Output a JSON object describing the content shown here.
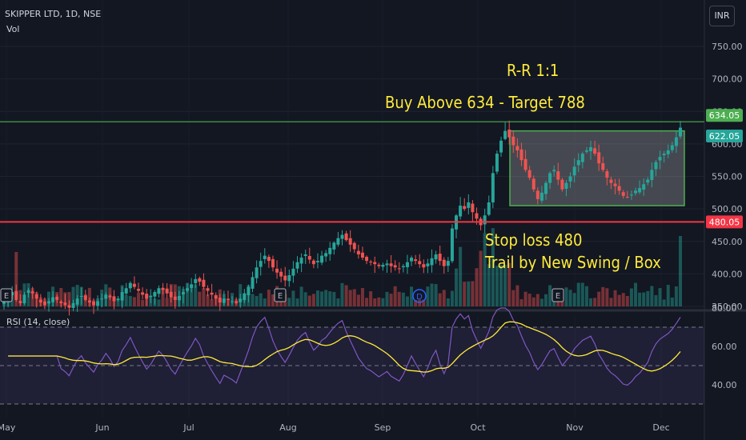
{
  "header": {
    "symbol": "SKIPPER LTD, 1D, NSE",
    "vol_label": "Vol",
    "currency_button": "INR",
    "rsi_label": "RSI (14, close)"
  },
  "annotations": {
    "rr": "R-R 1:1",
    "buy": "Buy Above 634 - Target 788",
    "stop": "Stop loss 480",
    "trail": "Trail by New Swing / Box"
  },
  "colors": {
    "background": "#131722",
    "up": "#26a69a",
    "down": "#ef5350",
    "target_line": "#4caf50",
    "stop_line": "#f23645",
    "rsi_line": "#7e57c2",
    "rsi_ma": "#ffeb3b",
    "annotation": "#ffeb3b"
  },
  "icons": {
    "earnings": "earnings-marker-icon",
    "dividend": "dividend-marker-icon"
  },
  "chart_data": [
    {
      "type": "candlestick",
      "title": "SKIPPER LTD, 1D, NSE",
      "x_tick_labels": [
        "May",
        "Jun",
        "Jul",
        "Aug",
        "Sep",
        "Oct",
        "Nov",
        "Dec"
      ],
      "y_ticks": [
        350,
        400,
        450,
        500,
        550,
        600,
        650,
        700,
        750
      ],
      "y_tick_labels": [
        "350.00",
        "400.00",
        "450.00",
        "500.00",
        "550.00",
        "600.00",
        "650.00",
        "700.00",
        "750.00"
      ],
      "ylim": [
        350,
        760
      ],
      "price_labels": [
        {
          "text": "634.05",
          "value": 634.05,
          "color": "#4caf50"
        },
        {
          "text": "622.05",
          "value": 622.05,
          "color": "#26a69a"
        },
        {
          "text": "480.05",
          "value": 480.05,
          "color": "#f23645"
        }
      ],
      "horizontal_lines": [
        {
          "name": "target",
          "value": 634.05,
          "color": "#4caf50"
        },
        {
          "name": "stop-loss",
          "value": 480.05,
          "color": "#f23645"
        }
      ],
      "box": {
        "x_start": "Oct 10",
        "x_end": "Dec 7",
        "y_low": 505,
        "y_high": 620
      },
      "markers": [
        {
          "label": "E",
          "x": "May"
        },
        {
          "label": "E",
          "x": "Aug"
        },
        {
          "label": "D",
          "x": "Sep 25"
        },
        {
          "label": "E",
          "x": "Nov"
        }
      ],
      "closes": [
        358,
        365,
        372,
        360,
        355,
        368,
        375,
        370,
        362,
        356,
        352,
        358,
        364,
        360,
        355,
        352,
        348,
        355,
        362,
        366,
        360,
        356,
        352,
        358,
        362,
        368,
        364,
        358,
        362,
        372,
        378,
        386,
        380,
        374,
        368,
        362,
        366,
        372,
        378,
        375,
        370,
        364,
        360,
        366,
        372,
        378,
        384,
        392,
        388,
        380,
        374,
        368,
        362,
        356,
        362,
        360,
        358,
        355,
        362,
        370,
        380,
        395,
        410,
        420,
        428,
        420,
        410,
        402,
        396,
        390,
        398,
        408,
        418,
        425,
        430,
        422,
        415,
        420,
        428,
        432,
        440,
        448,
        455,
        460,
        452,
        445,
        438,
        430,
        425,
        420,
        418,
        415,
        412,
        414,
        416,
        412,
        410,
        408,
        412,
        418,
        425,
        420,
        415,
        410,
        416,
        424,
        430,
        420,
        412,
        420,
        470,
        490,
        505,
        500,
        510,
        495,
        485,
        475,
        490,
        510,
        555,
        585,
        605,
        620,
        610,
        598,
        590,
        575,
        560,
        548,
        530,
        515,
        525,
        540,
        555,
        560,
        545,
        530,
        540,
        550,
        565,
        575,
        585,
        590,
        595,
        585,
        570,
        560,
        548,
        540,
        535,
        528,
        520,
        518,
        522,
        528,
        532,
        538,
        545,
        560,
        572,
        580,
        585,
        590,
        598,
        610,
        625
      ],
      "volume_scale": "relative",
      "rsi": {
        "label": "RSI (14, close)",
        "y_ticks": [
          40,
          60,
          80
        ],
        "y_tick_labels": [
          "40.00",
          "60.00",
          "80.00"
        ],
        "ylim": [
          30,
          82
        ],
        "levels": [
          30,
          50,
          70
        ]
      }
    }
  ]
}
